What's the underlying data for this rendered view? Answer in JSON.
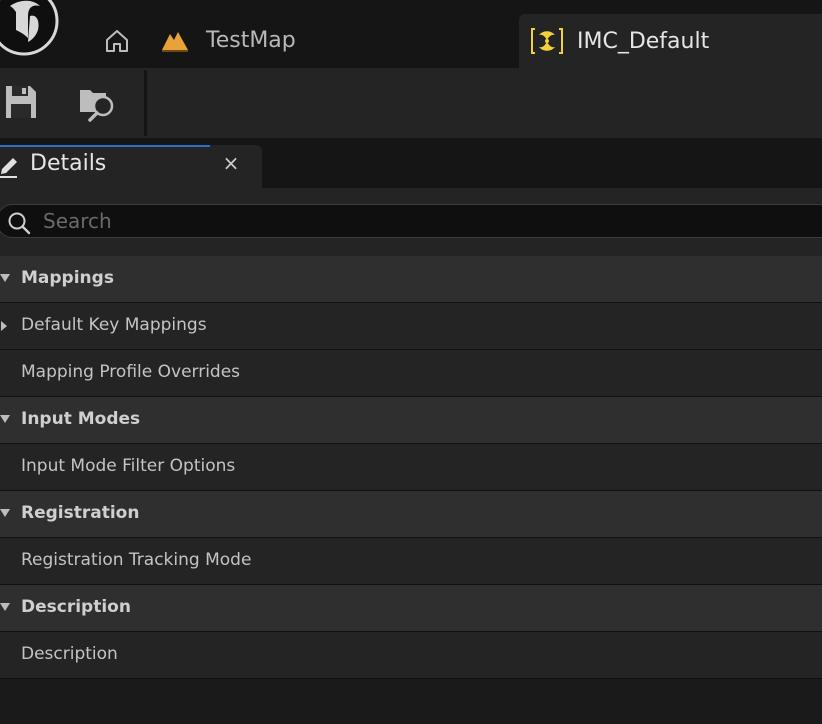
{
  "window": {
    "tabs": [
      {
        "label": "TestMap",
        "icon": "level-icon",
        "active": false
      },
      {
        "label": "IMC_Default",
        "icon": "input-mapping-context-icon",
        "active": true
      }
    ]
  },
  "toolbar": {
    "buttons": [
      {
        "icon": "save-icon"
      },
      {
        "icon": "browse-icon"
      }
    ]
  },
  "panel": {
    "title": "Details",
    "close_symbol": "×",
    "search": {
      "placeholder": "Search",
      "value": ""
    }
  },
  "details": {
    "rows": [
      {
        "kind": "category",
        "label": "Mappings",
        "expanded": true
      },
      {
        "kind": "property",
        "label": "Default Key Mappings",
        "expandable": true
      },
      {
        "kind": "property",
        "label": "Mapping Profile Overrides",
        "expandable": false
      },
      {
        "kind": "category",
        "label": "Input Modes",
        "expanded": true
      },
      {
        "kind": "property",
        "label": "Input Mode Filter Options",
        "expandable": false
      },
      {
        "kind": "category",
        "label": "Registration",
        "expanded": true
      },
      {
        "kind": "property",
        "label": "Registration Tracking Mode",
        "expandable": false
      },
      {
        "kind": "category",
        "label": "Description",
        "expanded": true
      },
      {
        "kind": "property",
        "label": "Description",
        "expandable": false
      }
    ]
  },
  "colors": {
    "accent": "#2f6ec9",
    "level_icon": "#e8a23a",
    "imc_icon": "#f2d13a",
    "panel_bg": "#242424",
    "category_bg": "#2f2f2f",
    "frame_bg": "#151515"
  }
}
